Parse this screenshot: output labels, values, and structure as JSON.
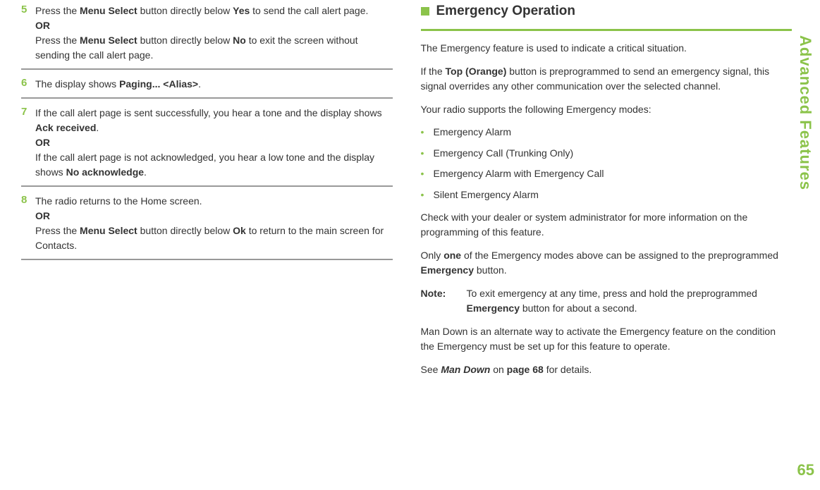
{
  "left": {
    "step5": {
      "num": "5",
      "line1a": "Press the ",
      "line1b": "Menu Select",
      "line1c": " button directly below ",
      "line1d": "Yes",
      "line1e": " to send the call alert page.",
      "or": "OR",
      "line2a": "Press the ",
      "line2b": "Menu Select",
      "line2c": " button directly below ",
      "line2d": "No",
      "line2e": " to exit the screen without sending the call alert page."
    },
    "step6": {
      "num": "6",
      "line1a": "The display shows ",
      "line1b": "Paging... <Alias>",
      "line1c": "."
    },
    "step7": {
      "num": "7",
      "line1a": "If the call alert page is sent successfully, you hear a tone and the display shows ",
      "line1b": "Ack received",
      "line1c": ".",
      "or": "OR",
      "line2a": "If the call alert page is not acknowledged, you hear a low tone and the display shows ",
      "line2b": "No acknowledge",
      "line2c": "."
    },
    "step8": {
      "num": "8",
      "line1": "The radio returns to the Home screen.",
      "or": "OR",
      "line2a": "Press the ",
      "line2b": "Menu Select",
      "line2c": " button directly below ",
      "line2d": "Ok",
      "line2e": " to return to the main screen for Contacts."
    }
  },
  "right": {
    "title": "Emergency Operation",
    "p1": "The Emergency feature is used to indicate a critical situation.",
    "p2a": "If the ",
    "p2b": "Top (Orange)",
    "p2c": " button is preprogrammed to send an emergency signal, this signal overrides any other communication over the selected channel.",
    "p3": "Your radio supports the following Emergency modes:",
    "bullets": [
      "Emergency Alarm",
      "Emergency Call (Trunking Only)",
      "Emergency Alarm with Emergency Call",
      "Silent Emergency Alarm"
    ],
    "p4": "Check with your dealer or system administrator for more information on the programming of this feature.",
    "p5a": "Only ",
    "p5b": "one",
    "p5c": " of the Emergency modes above can be assigned to the preprogrammed ",
    "p5d": "Emergency",
    "p5e": " button.",
    "noteLabel": "Note:",
    "noteText1": "To exit emergency at any time, press and hold the preprogrammed ",
    "noteText2": "Emergency",
    "noteText3": " button for about a second.",
    "p6": "Man Down is an alternate way to activate the Emergency feature on the condition the Emergency must be set up for this feature to operate.",
    "p7a": "See ",
    "p7b": "Man Down",
    "p7c": " on ",
    "p7d": "page 68",
    "p7e": " for details."
  },
  "side": "Advanced Features",
  "pageNum": "65"
}
